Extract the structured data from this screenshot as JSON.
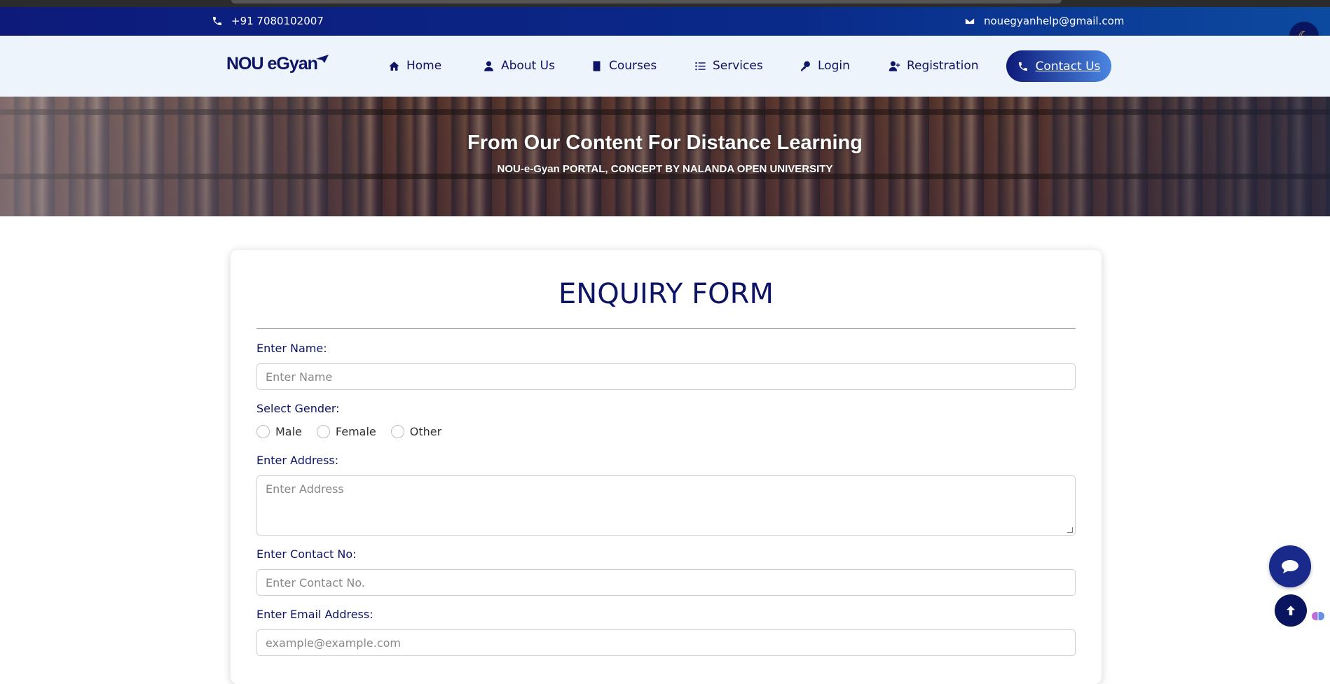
{
  "topbar": {
    "phone": "+91 7080102007",
    "email": "nouegyanhelp@gmail.com"
  },
  "darkmode": {
    "icon": "moon-icon"
  },
  "navbar": {
    "logo": "NOU eGyan",
    "items": [
      {
        "label": "Home",
        "icon": "home-icon"
      },
      {
        "label": "About Us",
        "icon": "user-icon"
      },
      {
        "label": "Courses",
        "icon": "book-icon"
      },
      {
        "label": "Services",
        "icon": "list-icon"
      },
      {
        "label": "Login",
        "icon": "key-icon"
      },
      {
        "label": "Registration",
        "icon": "user-plus-icon"
      }
    ],
    "contact": "Contact Us"
  },
  "hero": {
    "title": "From Our Content For Distance Learning",
    "subtitle": "NOU-e-Gyan PORTAL, CONCEPT BY NALANDA OPEN UNIVERSITY"
  },
  "form": {
    "title": "ENQUIRY FORM",
    "name_label": "Enter Name:",
    "name_placeholder": "Enter Name",
    "gender_label": "Select Gender:",
    "gender_options": [
      "Male",
      "Female",
      "Other"
    ],
    "address_label": "Enter Address:",
    "address_placeholder": "Enter Address",
    "contact_label": "Enter Contact No:",
    "contact_placeholder": "Enter Contact No.",
    "email_label": "Enter Email Address:",
    "email_placeholder": "example@example.com"
  },
  "colors": {
    "primary": "#0d1466",
    "accent": "#4a86e0",
    "nav_bg": "#eef4fb"
  }
}
